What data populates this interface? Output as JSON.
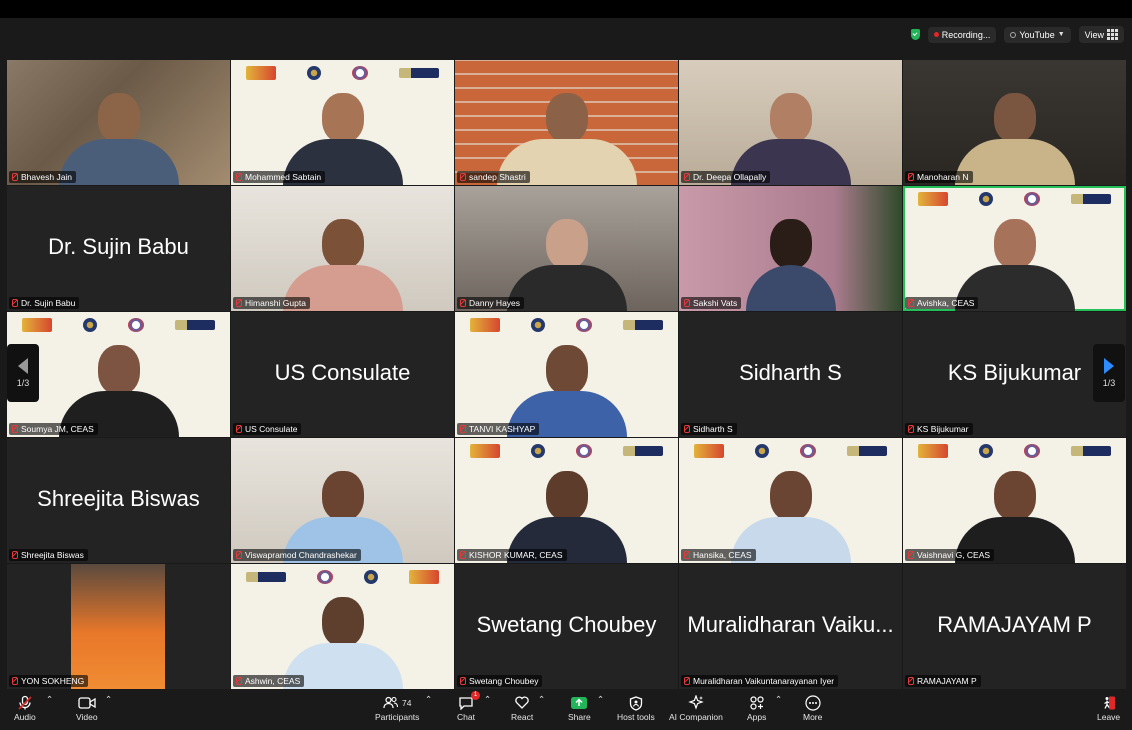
{
  "top": {
    "recording_label": "Recording...",
    "stream_label": "YouTube",
    "view_label": "View"
  },
  "pagination": {
    "left": "1/3",
    "right": "1/3"
  },
  "tiles": [
    {
      "label": "Bhavesh Jain"
    },
    {
      "label": "Mohammed Sabtain"
    },
    {
      "label": "sandep Shastri"
    },
    {
      "label": "Dr. Deepa Ollapally"
    },
    {
      "label": "Manoharan N"
    },
    {
      "big": "Dr. Sujin Babu",
      "label": "Dr. Sujin Babu"
    },
    {
      "label": "Himanshi Gupta"
    },
    {
      "label": "Danny Hayes"
    },
    {
      "label": "Sakshi Vats"
    },
    {
      "label": "Avishka, CEAS"
    },
    {
      "label": "Soumya JM, CEAS"
    },
    {
      "big": "US Consulate",
      "label": "US Consulate"
    },
    {
      "label": "TANVI KASHYAP"
    },
    {
      "big": "Sidharth S",
      "label": "Sidharth S"
    },
    {
      "big": "KS Bijukumar",
      "label": "KS Bijukumar"
    },
    {
      "big": "Shreejita Biswas",
      "label": "Shreejita Biswas"
    },
    {
      "label": "Viswapramod Chandrashekar"
    },
    {
      "label": "KISHOR KUMAR, CEAS"
    },
    {
      "label": "Hansika, CEAS"
    },
    {
      "label": "Vaishnavi G, CEAS"
    },
    {
      "label": "YON SOKHENG"
    },
    {
      "label": "Ashwin, CEAS"
    },
    {
      "big": "Swetang Choubey",
      "label": "Swetang Choubey"
    },
    {
      "big": "Muralidharan Vaiku...",
      "label": "Muralidharan Vaikuntanarayanan Iyer"
    },
    {
      "big": "RAMAJAYAM P",
      "label": "RAMAJAYAM P"
    }
  ],
  "toolbar": {
    "audio": "Audio",
    "video": "Video",
    "participants": "Participants",
    "participants_count": "74",
    "chat": "Chat",
    "chat_badge": "1",
    "react": "React",
    "share": "Share",
    "host_tools": "Host tools",
    "ai_companion": "AI Companion",
    "apps": "Apps",
    "more": "More",
    "leave": "Leave"
  },
  "colors": {
    "active_speaker": "#23c05a",
    "share_green": "#23b45a",
    "leave_red": "#e02828",
    "nav_blue": "#2d8cff"
  }
}
